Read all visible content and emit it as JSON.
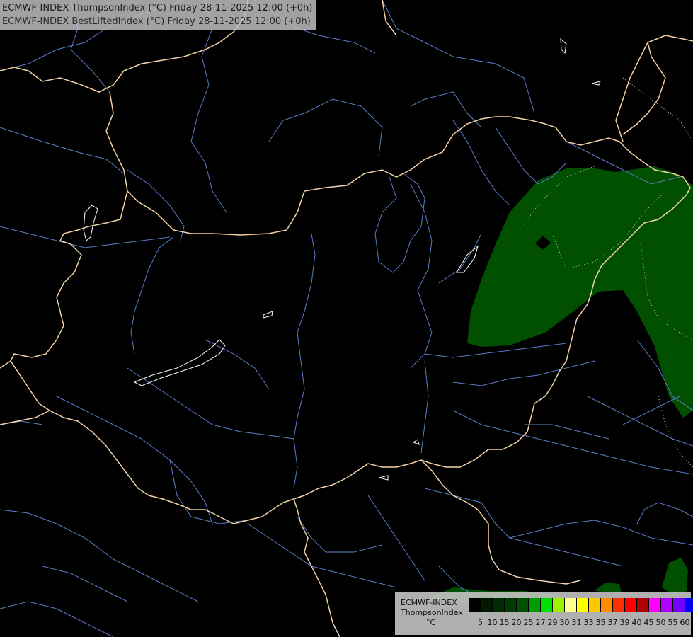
{
  "header": {
    "line1": "ECMWF-INDEX ThompsonIndex (°C) Friday 28-11-2025 12:00 (+0h)",
    "line2": "ECMWF-INDEX BestLiftedIndex (°C) Friday 28-11-2025 12:00 (+0h)"
  },
  "legend": {
    "model": "ECMWF-INDEX",
    "param": "ThompsonIndex",
    "unit": "°C",
    "ticks": [
      "5",
      "10",
      "15",
      "20",
      "25",
      "27",
      "29",
      "30",
      "31",
      "33",
      "35",
      "37",
      "39",
      "40",
      "45",
      "50",
      "55",
      "60"
    ],
    "colors": [
      "#000000",
      "#001a00",
      "#002b00",
      "#003a00",
      "#005000",
      "#009b00",
      "#00e000",
      "#9cf000",
      "#ffff90",
      "#ffff00",
      "#ffc800",
      "#ff8c00",
      "#ff3000",
      "#ff0000",
      "#b00000",
      "#ff00ff",
      "#b000ff",
      "#7000ff",
      "#0000ff"
    ]
  },
  "colors": {
    "background": "#000000",
    "border": "#f4d2a8",
    "river": "#5a7ec8",
    "lake": "#ffffff",
    "index_fill": "#005000"
  }
}
